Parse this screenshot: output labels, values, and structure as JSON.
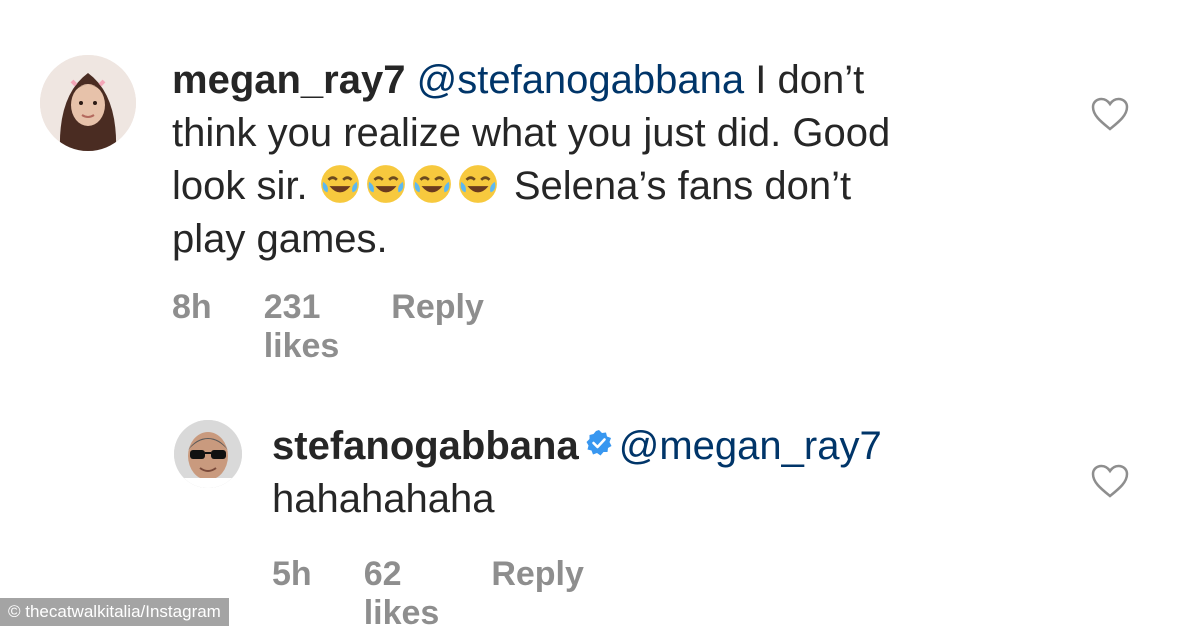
{
  "comments": [
    {
      "username": "megan_ray7",
      "mention": "@stefanogabbana",
      "text_line1": " I don’t",
      "text_line2": "think you realize what you just did. Good",
      "text_line3_start": "look sir. ",
      "text_line3_end": " Selena’s fans don’t",
      "text_line4": "play games.",
      "emoji": "face-with-tears-of-joy-icon",
      "emoji_count": 4,
      "time": "8h",
      "likes": "231 likes",
      "reply": "Reply"
    },
    {
      "username": "stefanogabbana",
      "verified": true,
      "mention": "@megan_ray7",
      "text": "hahahahaha",
      "time": "5h",
      "likes": "62 likes",
      "reply": "Reply"
    }
  ],
  "watermark": "© thecatwalkitalia/Instagram",
  "colors": {
    "text": "#262626",
    "mention": "#003569",
    "meta": "#8e8e8e",
    "verified": "#3897f0"
  }
}
